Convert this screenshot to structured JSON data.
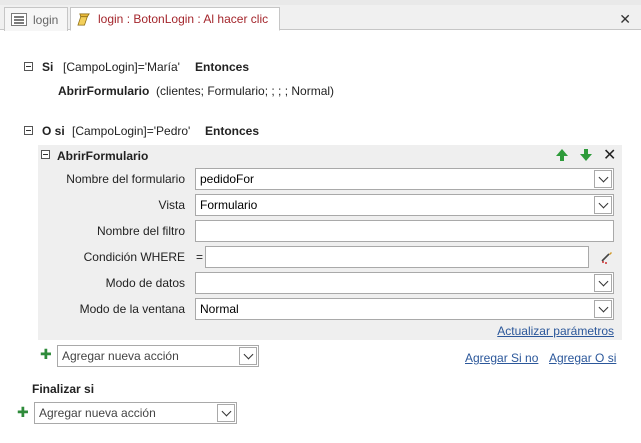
{
  "tabs": [
    {
      "label": "login"
    },
    {
      "label": "login : BotonLogin : Al hacer clic"
    }
  ],
  "tab_close_glyph": "✕",
  "block1": {
    "keyword_if": "Si",
    "condition": "[CampoLogin]='María'",
    "keyword_then": "Entonces",
    "action_name": "AbrirFormulario",
    "action_args": "(clientes; Formulario; ; ; ; Normal)"
  },
  "block2": {
    "keyword_elseif": "O si",
    "condition": "[CampoLogin]='Pedro'",
    "keyword_then": "Entonces",
    "action": {
      "title": "AbrirFormulario",
      "fields": {
        "form_name": {
          "label": "Nombre del formulario",
          "value": "pedidoFor"
        },
        "view": {
          "label": "Vista",
          "value": "Formulario"
        },
        "filter_name": {
          "label": "Nombre del filtro",
          "value": ""
        },
        "where": {
          "label": "Condición WHERE",
          "prefix": "=",
          "value": ""
        },
        "data_mode": {
          "label": "Modo de datos",
          "value": ""
        },
        "window_mode": {
          "label": "Modo de la ventana",
          "value": "Normal"
        }
      },
      "update_params": "Actualizar parámetros"
    },
    "add_action_placeholder": "Agregar nueva acción",
    "add_else": "Agregar Si no",
    "add_elseif": "Agregar O si"
  },
  "end_if": "Finalizar si",
  "bottom_add_action_placeholder": "Agregar nueva acción",
  "colors": {
    "accent": "#a4262c",
    "link": "#2b579a",
    "green": "#2e9b3a"
  }
}
